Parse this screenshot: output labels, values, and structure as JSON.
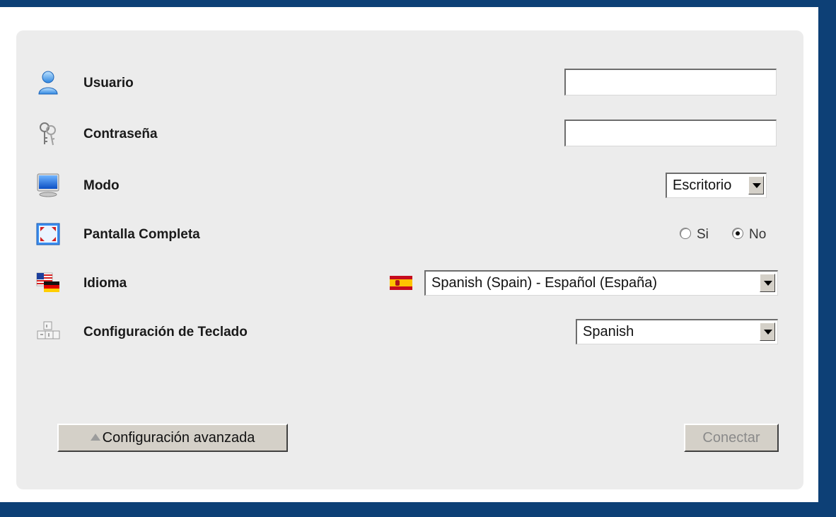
{
  "form": {
    "usuario": {
      "label": "Usuario",
      "value": ""
    },
    "contrasena": {
      "label": "Contraseña",
      "value": ""
    },
    "modo": {
      "label": "Modo",
      "selected": "Escritorio"
    },
    "pantalla": {
      "label": "Pantalla Completa",
      "option_si": "Si",
      "option_no": "No",
      "selected": "No"
    },
    "idioma": {
      "label": "Idioma",
      "selected": "Spanish (Spain) - Español (España)"
    },
    "teclado": {
      "label": "Configuración de Teclado",
      "selected": "Spanish"
    }
  },
  "buttons": {
    "advanced": "Configuración avanzada",
    "connect": "Conectar"
  },
  "colors": {
    "frame": "#0d4076",
    "panel": "#ececec"
  },
  "icons": {
    "usuario": "user-icon",
    "contrasena": "keys-icon",
    "modo": "monitor-icon",
    "pantalla": "fullscreen-icon",
    "idioma": "flags-icon",
    "teclado": "keyboard-icon",
    "flag": "spain-flag-icon"
  }
}
